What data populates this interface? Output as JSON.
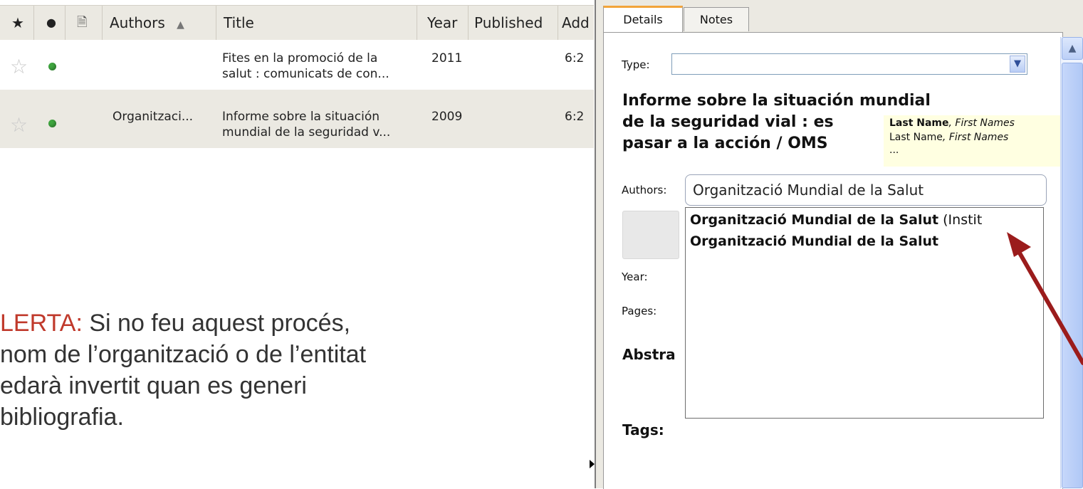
{
  "list": {
    "columns": [
      "Authors",
      "Title",
      "Year",
      "Published",
      "Add"
    ],
    "sort_indicator": "▲",
    "rows": [
      {
        "author": "",
        "title_line1": "Fites en  la promoció de la",
        "title_line2": "salut : comunicats de con...",
        "year": "2011",
        "added": "6:2"
      },
      {
        "author": "Organitzaci...",
        "title_line1": "Informe sobre la situación",
        "title_line2": "mundial de la seguridad v...",
        "year": "2009",
        "added": "6:2"
      }
    ]
  },
  "alert": {
    "keyword": "LERTA:",
    "line1": " Si no feu aquest procés,",
    "line2": "nom de l’organització o de l’entitat",
    "line3": "edarà invertit quan es generi",
    "line4": "bibliografia."
  },
  "tabs": {
    "details": "Details",
    "notes": "Notes"
  },
  "details": {
    "type_label": "Type:",
    "type_value": "",
    "title_line1": "Informe sobre la situación mundial",
    "title_line2": "de la seguridad vial : es",
    "title_line3": "pasar a la acción / OMS",
    "tooltip_line1_bold": "Last Name",
    "tooltip_line1_rest": ", First Names",
    "tooltip_line2_plain": "Last Name",
    "tooltip_line2_rest": ", First Names",
    "tooltip_line3": "...",
    "authors_label": "Authors:",
    "authors_value": "Organització Mundial de la Salut",
    "year_label": "Year:",
    "pages_label": "Pages:",
    "abstract_label": "Abstra",
    "tags_label": "Tags:"
  },
  "autocomplete": [
    {
      "bold": "Organització Mundial de la Salut",
      "suffix": " (Instit"
    },
    {
      "bold": "Organització Mundial de la Salut",
      "suffix": ""
    }
  ],
  "colors": {
    "alert": "#c0392b",
    "arrow": "#9b1c1c",
    "status_dot": "#3fa63f",
    "selected_tab": "#f2a43a"
  }
}
